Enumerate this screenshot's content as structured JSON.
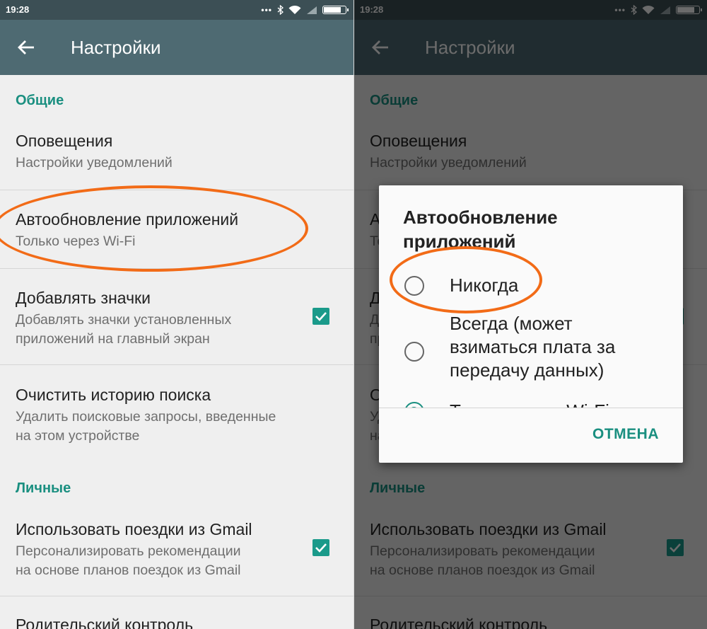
{
  "status": {
    "time": "19:28",
    "battery_level": 0.75
  },
  "appbar": {
    "title": "Настройки"
  },
  "general": {
    "header": "Общие",
    "notifications": {
      "title": "Оповещения",
      "subtitle": "Настройки уведомлений"
    },
    "autoupdate": {
      "title": "Автообновление приложений",
      "subtitle": "Только через Wi-Fi"
    },
    "icons": {
      "title": "Добавлять значки",
      "subtitle": "Добавлять значки установленных\nприложений на главный экран",
      "checked": true
    },
    "clear_history": {
      "title": "Очистить историю поиска",
      "subtitle": "Удалить поисковые запросы, введенные\nна этом устройстве"
    }
  },
  "personal": {
    "header": "Личные",
    "gmail": {
      "title": "Использовать поездки из Gmail",
      "subtitle": "Персонализировать рекомендации\nна основе планов поездок из Gmail",
      "checked": true
    },
    "parental": {
      "title": "Родительский контроль"
    }
  },
  "dialog": {
    "title": "Автообновление\nприложений",
    "options": [
      {
        "label": "Никогда",
        "selected": false
      },
      {
        "label": "Всегда (может\nвзиматься плата за\nпередачу данных)",
        "selected": false
      },
      {
        "label": "Только через Wi-Fi",
        "selected": true
      }
    ],
    "cancel_label": "ОТМЕНА"
  },
  "colors": {
    "accent": "#1a8f80",
    "highlight_ring": "#f26b17",
    "appbar": "#4e6a72"
  }
}
